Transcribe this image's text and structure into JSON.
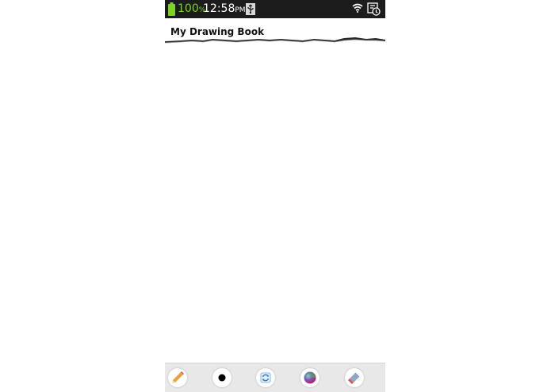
{
  "status_bar": {
    "battery_percent": "100",
    "battery_percent_sign": "%",
    "time": "12:58",
    "time_ampm": "PM",
    "icons": [
      "battery-icon",
      "usb-icon",
      "wifi-icon",
      "notification-icon"
    ]
  },
  "app": {
    "title": "My Drawing Book"
  },
  "toolbar": {
    "tools": [
      {
        "name": "pencil-tool",
        "icon": "pencil-icon"
      },
      {
        "name": "brush-size-tool",
        "icon": "dot-icon"
      },
      {
        "name": "refresh-tool",
        "icon": "refresh-icon"
      },
      {
        "name": "color-picker-tool",
        "icon": "color-wheel-icon"
      },
      {
        "name": "eraser-tool",
        "icon": "eraser-icon"
      }
    ]
  },
  "colors": {
    "status_bar_bg": "#1c1c1c",
    "battery_green": "#7ed321",
    "toolbar_bg": "#e8e8e8",
    "canvas_bg": "#ffffff"
  }
}
